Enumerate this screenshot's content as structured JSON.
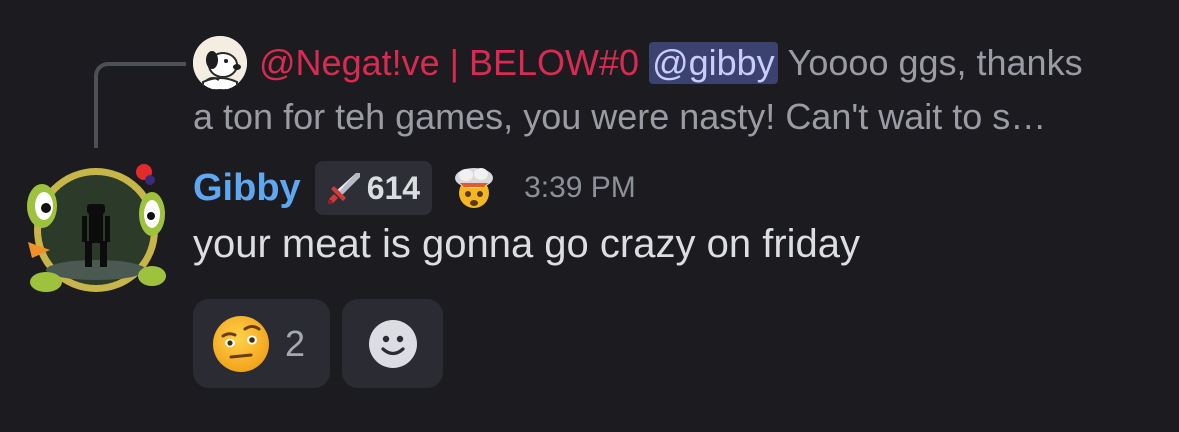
{
  "reply": {
    "author": "@Negat!ve | BELOW#0",
    "mention": "@gibby",
    "text_line1": "Yoooo ggs, thanks",
    "text_line2": "a ton for teh games, you were nasty! Can't wait to s…",
    "author_color": "#d92b52"
  },
  "message": {
    "username": "Gibby",
    "username_color": "#5ea8f2",
    "tag_icon": "sword-icon",
    "tag_value": "614",
    "timestamp": "3:39 PM",
    "content": "your meat is gonna go crazy on friday"
  },
  "reactions": [
    {
      "emoji": "face-with-raised-eyebrow",
      "count": "2"
    }
  ],
  "add_reaction_icon": "smiley-add-reaction-icon"
}
